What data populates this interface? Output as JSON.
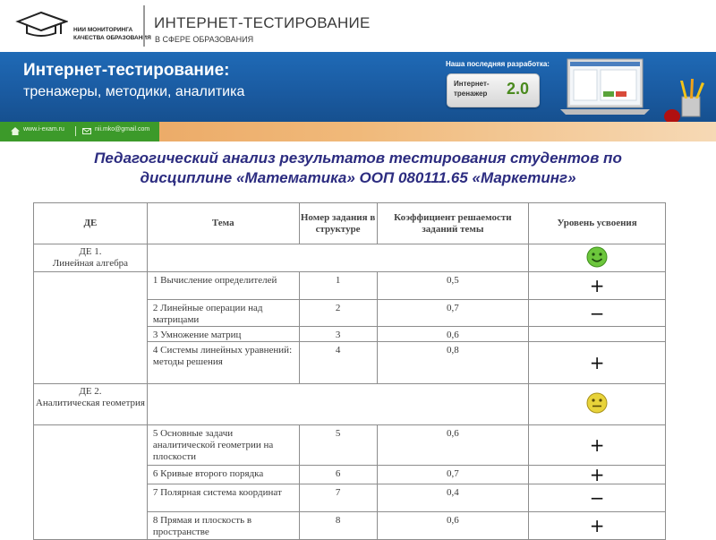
{
  "header": {
    "org_line1": "НИИ МОНИТОРИНГА",
    "org_line2": "КАЧЕСТВА ОБРАЗОВАНИЯ",
    "brand_title": "ИНТЕРНЕТ-ТЕСТИРОВАНИЕ",
    "brand_subtitle": "В СФЕРЕ ОБРАЗОВАНИЯ"
  },
  "banner": {
    "title": "Интернет-тестирование:",
    "subtitle": "тренажеры, методики, аналитика",
    "latest_label": "Наша последняя разработка:",
    "trainer_line1": "Интернет-",
    "trainer_line2": "тренажер",
    "trainer_version": "2.0"
  },
  "links": {
    "site": "www.i-exam.ru",
    "email": "nii.mko@gmail.com"
  },
  "page": {
    "heading_line1": "Педагогический анализ результатов тестирования студентов по",
    "heading_line2": "дисциплине «Математика» ООП 080111.65  «Маркетинг»"
  },
  "table": {
    "headers": {
      "de": "ДЕ",
      "topic": "Тема",
      "task_num": "Номер задания в структуре",
      "coef": "Коэффициент решаемости заданий темы",
      "level": "Уровень усвоения"
    },
    "sections": [
      {
        "de_line1": "ДЕ 1.",
        "de_line2": "Линейная алгебра",
        "level_icon": "smiley-happy-icon",
        "rows": [
          {
            "topic": "1 Вычисление определителей",
            "num": "1",
            "coef": "0,5",
            "level": "+"
          },
          {
            "topic": "2 Линейные операции над матрицами",
            "num": "2",
            "coef": "0,7",
            "level": "−"
          },
          {
            "topic": "3 Умножение матриц",
            "num": "3",
            "coef": "0,6",
            "level": ""
          },
          {
            "topic": "4 Системы линейных уравнений: методы решения",
            "num": "4",
            "coef": "0,8",
            "level": "+"
          }
        ]
      },
      {
        "de_line1": "ДЕ 2.",
        "de_line2": "Аналитическая геометрия",
        "level_icon": "smiley-neutral-icon",
        "rows": [
          {
            "topic": "5 Основные задачи аналитической геометрии на плоскости",
            "num": "5",
            "coef": "0,6",
            "level": "+"
          },
          {
            "topic": "6 Кривые второго порядка",
            "num": "6",
            "coef": "0,7",
            "level": "+"
          },
          {
            "topic": "7 Полярная система координат",
            "num": "7",
            "coef": "0,4",
            "level": "−"
          },
          {
            "topic": "8 Прямая и плоскость в пространстве",
            "num": "8",
            "coef": "0,6",
            "level": "+"
          }
        ]
      }
    ]
  },
  "colors": {
    "banner_blue": "#1a5aa0",
    "strip_orange": "#f0b97a",
    "link_green": "#3c9a2a",
    "heading": "#2c2c80",
    "smiley_happy": "#6cc63c",
    "smiley_neutral": "#e8d33a"
  }
}
